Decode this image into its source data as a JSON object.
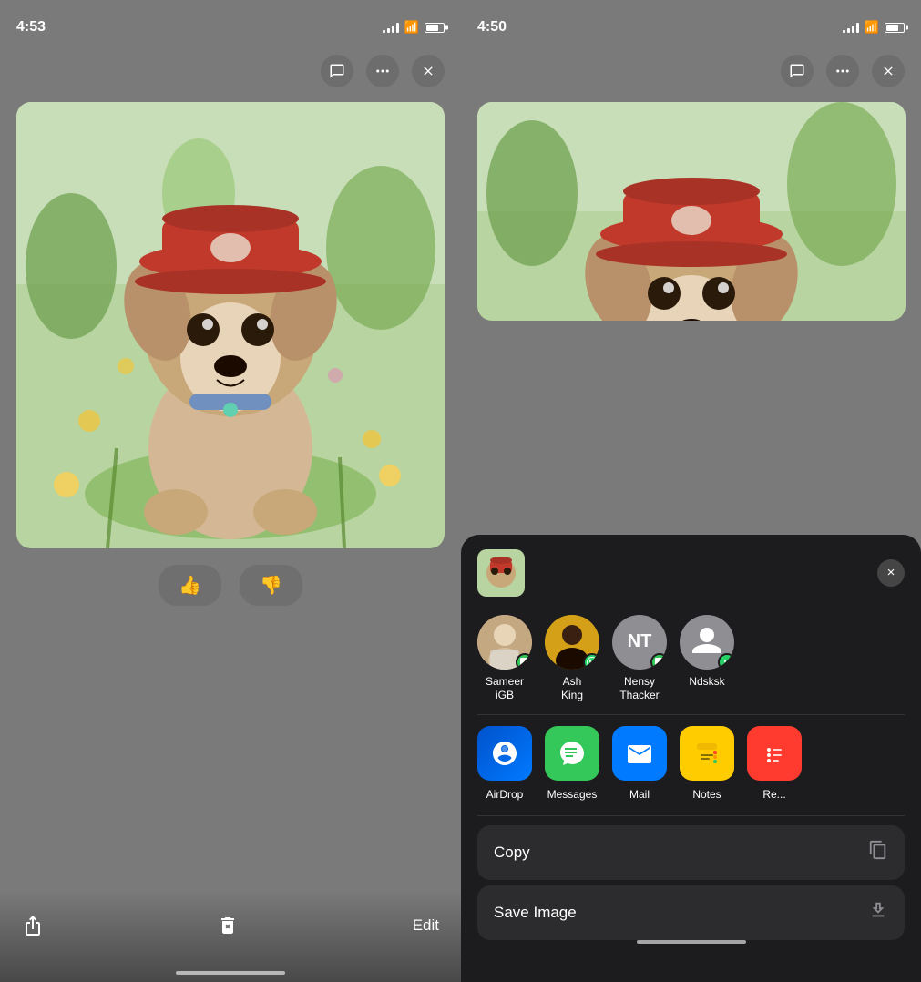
{
  "left_phone": {
    "status_time": "4:53",
    "top_actions": {
      "comment_label": "comment",
      "more_label": "more",
      "close_label": "close"
    },
    "feedback": {
      "thumbs_up": "👍",
      "thumbs_down": "👎"
    },
    "toolbar": {
      "share_label": "Share",
      "delete_label": "Delete",
      "edit_label": "Edit"
    }
  },
  "right_phone": {
    "status_time": "4:50",
    "share_sheet": {
      "close_label": "×",
      "contacts": [
        {
          "name": "Sameer\niGB",
          "avatar_type": "sameer",
          "badge": "messages"
        },
        {
          "name": "Ash\nKing",
          "avatar_type": "ash",
          "badge": "whatsapp"
        },
        {
          "name": "Nensy\nThacker",
          "avatar_type": "nt",
          "initials": "NT",
          "badge": "messages"
        },
        {
          "name": "Ndsksk",
          "avatar_type": "ndsksk",
          "badge": "whatsapp"
        }
      ],
      "apps": [
        {
          "name": "AirDrop",
          "type": "airdrop"
        },
        {
          "name": "Messages",
          "type": "messages"
        },
        {
          "name": "Mail",
          "type": "mail"
        },
        {
          "name": "Notes",
          "type": "notes"
        },
        {
          "name": "Re...",
          "type": "remind"
        }
      ],
      "actions": [
        {
          "label": "Copy",
          "icon": "copy"
        },
        {
          "label": "Save Image",
          "icon": "save"
        }
      ]
    }
  }
}
